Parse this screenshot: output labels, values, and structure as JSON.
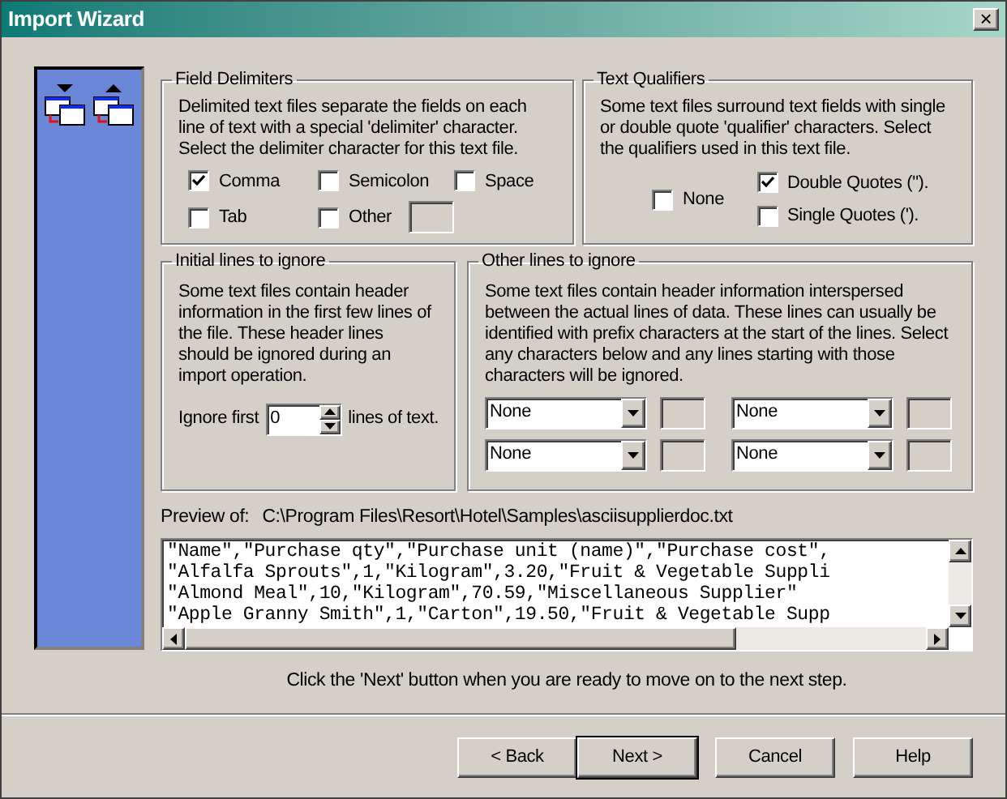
{
  "window": {
    "title": "Import Wizard",
    "close": "×"
  },
  "field_delimiters": {
    "title": "Field Delimiters",
    "description": "Delimited text files separate the fields on each line of text with a special 'delimiter' character. Select the delimiter character for this text file.",
    "options": [
      {
        "label": "Comma",
        "checked": true
      },
      {
        "label": "Semicolon",
        "checked": false
      },
      {
        "label": "Space",
        "checked": false
      },
      {
        "label": "Tab",
        "checked": false
      },
      {
        "label": "Other",
        "checked": false
      }
    ]
  },
  "text_qualifiers": {
    "title": "Text Qualifiers",
    "description": "Some text files surround text fields with single or double quote 'qualifier' characters.  Select the qualifiers used in this text file.",
    "options": [
      {
        "label": "None",
        "checked": false
      },
      {
        "label": "Double Quotes (\").",
        "checked": true
      },
      {
        "label": "Single Quotes (').",
        "checked": false
      }
    ]
  },
  "initial_lines": {
    "title": "Initial lines to ignore",
    "description": "Some text files contain header information in the first few lines of the file.  These header lines should be ignored during an import operation.",
    "prefix": "Ignore first",
    "value": "0",
    "suffix": "lines of text."
  },
  "other_lines": {
    "title": "Other lines to ignore",
    "description": "Some text files contain header information interspersed between the actual lines of data. These lines can usually be identified with prefix characters at the start of the lines. Select any characters below and any lines starting with those characters will be ignored.",
    "selectors": [
      {
        "value": "None"
      },
      {
        "value": "None"
      },
      {
        "value": "None"
      },
      {
        "value": "None"
      }
    ]
  },
  "preview": {
    "label": "Preview of:",
    "path": "C:\\Program Files\\Resort\\Hotel\\Samples\\asciisupplierdoc.txt",
    "lines": [
      "\"Name\",\"Purchase qty\",\"Purchase unit (name)\",\"Purchase cost\",",
      "\"Alfalfa Sprouts\",1,\"Kilogram\",3.20,\"Fruit & Vegetable Suppli",
      "\"Almond Meal\",10,\"Kilogram\",70.59,\"Miscellaneous Supplier\"",
      "\"Apple Granny Smith\",1,\"Carton\",19.50,\"Fruit & Vegetable Supp"
    ]
  },
  "hint": "Click the 'Next' button when you are ready to move on to the next step.",
  "buttons": [
    {
      "label": "< Back",
      "default": false
    },
    {
      "label": "Next >",
      "default": true
    },
    {
      "label": "Cancel",
      "default": false
    },
    {
      "label": "Help",
      "default": false
    }
  ]
}
